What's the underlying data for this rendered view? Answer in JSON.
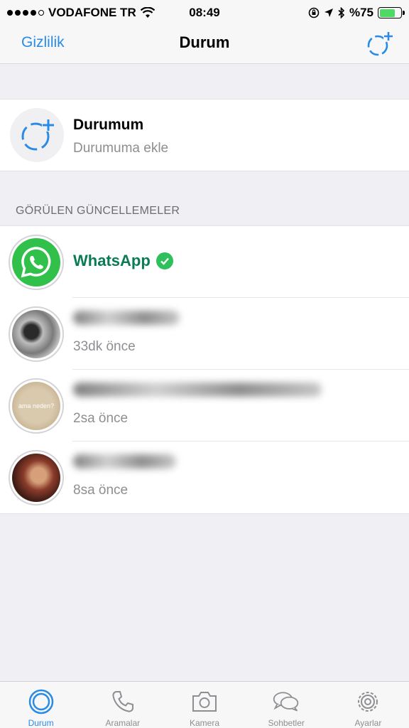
{
  "status_bar": {
    "carrier": "VODAFONE TR",
    "time": "08:49",
    "battery": "%75",
    "battery_level": 0.75
  },
  "nav": {
    "left": "Gizlilik",
    "title": "Durum",
    "right_icon": "new-status-icon"
  },
  "my_status": {
    "title": "Durumum",
    "subtitle": "Durumuma ekle",
    "icon": "add-status-icon"
  },
  "section_header": "GÖRÜLEN GÜNCELLEMELER",
  "updates": [
    {
      "name": "WhatsApp",
      "time": "",
      "verified": true
    },
    {
      "name": "",
      "time": "33dk önce"
    },
    {
      "name": "",
      "time": "2sa önce",
      "thumb_text": "ama neden?"
    },
    {
      "name": "",
      "time": "8sa önce"
    }
  ],
  "tabs": [
    {
      "label": "Durum",
      "icon": "status-icon",
      "active": true
    },
    {
      "label": "Aramalar",
      "icon": "phone-icon"
    },
    {
      "label": "Kamera",
      "icon": "camera-icon"
    },
    {
      "label": "Sohbetler",
      "icon": "chat-bubbles-icon"
    },
    {
      "label": "Ayarlar",
      "icon": "gear-icon"
    }
  ],
  "colors": {
    "accent": "#2a8be5",
    "whatsapp_green": "#31c14a",
    "verified_green": "#2ec05c",
    "name_green": "#0b7a57"
  }
}
